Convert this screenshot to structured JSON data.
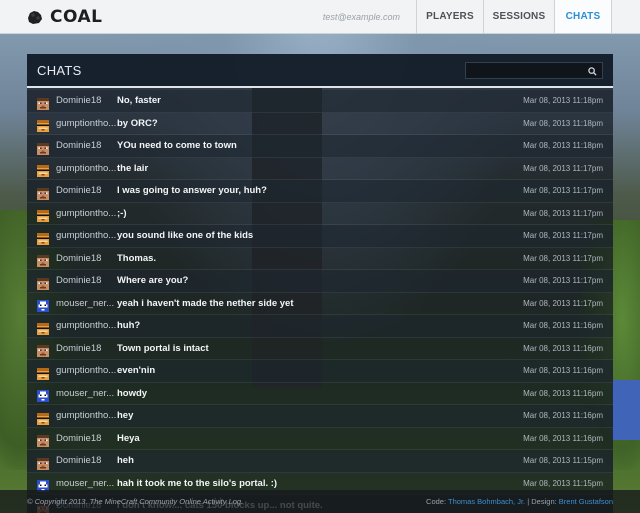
{
  "app": {
    "name": "COAL",
    "logo_icon": "coal-lump-icon"
  },
  "header": {
    "email": "test@example.com",
    "nav": [
      {
        "label": "PLAYERS",
        "active": false
      },
      {
        "label": "SESSIONS",
        "active": false
      },
      {
        "label": "CHATS",
        "active": true
      }
    ],
    "accent_color": "#2b8fd6"
  },
  "panel": {
    "title": "CHATS",
    "search": {
      "placeholder": "",
      "icon": "search-icon"
    }
  },
  "chats": [
    {
      "user": "Dominie18",
      "avatar": "avatar-dominie-icon",
      "message": "No, faster",
      "time": "Mar 08, 2013 11:18pm"
    },
    {
      "user": "gumptiontho...",
      "avatar": "avatar-gumption-icon",
      "message": "by ORC?",
      "time": "Mar 08, 2013 11:18pm"
    },
    {
      "user": "Dominie18",
      "avatar": "avatar-dominie-icon",
      "message": "YOu need to come to town",
      "time": "Mar 08, 2013 11:18pm"
    },
    {
      "user": "gumptiontho...",
      "avatar": "avatar-gumption-icon",
      "message": "the lair",
      "time": "Mar 08, 2013 11:17pm"
    },
    {
      "user": "Dominie18",
      "avatar": "avatar-dominie-icon",
      "message": "I was going to answer your, huh?",
      "time": "Mar 08, 2013 11:17pm"
    },
    {
      "user": "gumptiontho...",
      "avatar": "avatar-gumption-icon",
      "message": ";-)",
      "time": "Mar 08, 2013 11:17pm"
    },
    {
      "user": "gumptiontho...",
      "avatar": "avatar-gumption-icon",
      "message": "you sound like one of the kids",
      "time": "Mar 08, 2013 11:17pm"
    },
    {
      "user": "Dominie18",
      "avatar": "avatar-dominie-icon",
      "message": "Thomas.",
      "time": "Mar 08, 2013 11:17pm"
    },
    {
      "user": "Dominie18",
      "avatar": "avatar-dominie-icon",
      "message": "Where are you?",
      "time": "Mar 08, 2013 11:17pm"
    },
    {
      "user": "mouser_ner...",
      "avatar": "avatar-mouser-icon",
      "message": "yeah i haven't made the nether side yet",
      "time": "Mar 08, 2013 11:17pm"
    },
    {
      "user": "gumptiontho...",
      "avatar": "avatar-gumption-icon",
      "message": "huh?",
      "time": "Mar 08, 2013 11:16pm"
    },
    {
      "user": "Dominie18",
      "avatar": "avatar-dominie-icon",
      "message": "Town portal is intact",
      "time": "Mar 08, 2013 11:16pm"
    },
    {
      "user": "gumptiontho...",
      "avatar": "avatar-gumption-icon",
      "message": "even'nin",
      "time": "Mar 08, 2013 11:16pm"
    },
    {
      "user": "mouser_ner...",
      "avatar": "avatar-mouser-icon",
      "message": "howdy",
      "time": "Mar 08, 2013 11:16pm"
    },
    {
      "user": "gumptiontho...",
      "avatar": "avatar-gumption-icon",
      "message": "hey",
      "time": "Mar 08, 2013 11:16pm"
    },
    {
      "user": "Dominie18",
      "avatar": "avatar-dominie-icon",
      "message": "Heya",
      "time": "Mar 08, 2013 11:16pm"
    },
    {
      "user": "Dominie18",
      "avatar": "avatar-dominie-icon",
      "message": "heh",
      "time": "Mar 08, 2013 11:15pm"
    },
    {
      "user": "mouser_ner...",
      "avatar": "avatar-mouser-icon",
      "message": "hah it took me to the silo's portal. :)",
      "time": "Mar 08, 2013 11:15pm"
    },
    {
      "user": "Dominie18",
      "avatar": "avatar-dominie-icon",
      "message": "I don't know.... cats 150 blocks up... not quite.",
      "time": ""
    }
  ],
  "footer": {
    "copyright": "© Copyright 2013. The MineCraft Community Online Activity Log.",
    "code_label": "Code:",
    "code_author": "Thomas Bohmbach, Jr.",
    "separator": "|",
    "design_label": "Design:",
    "design_author": "Brent Gustafson"
  }
}
